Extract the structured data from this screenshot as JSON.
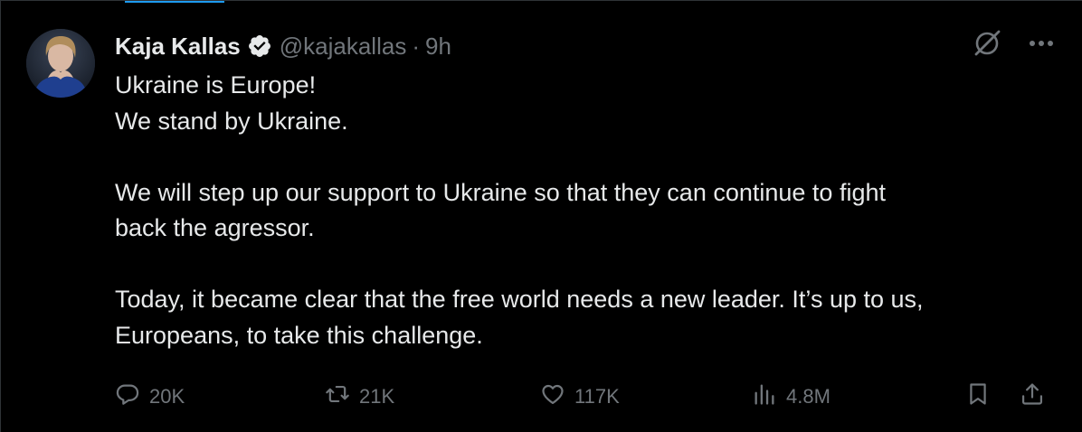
{
  "author": {
    "name": "Kaja Kallas",
    "handle": "@kajakallas",
    "separator": "·",
    "time": "9h"
  },
  "tweet": {
    "paragraphs": [
      [
        "Ukraine is Europe!",
        "We stand by Ukraine."
      ],
      [
        "We will step up our support to Ukraine so that they can continue to fight",
        "back the agressor."
      ],
      [
        "Today, it became clear that the free world needs a new leader. It’s up to us,",
        "Europeans, to take this challenge."
      ]
    ]
  },
  "actions": {
    "replies": "20K",
    "reposts": "21K",
    "likes": "117K",
    "views": "4.8M"
  },
  "icons": {
    "verified": "verified-badge-icon",
    "grok": "grok-icon",
    "more": "more-icon",
    "reply": "reply-icon",
    "repost": "repost-icon",
    "like": "heart-icon",
    "views": "views-icon",
    "bookmark": "bookmark-icon",
    "share": "share-icon"
  },
  "colors": {
    "background": "#000000",
    "text": "#e7e9ea",
    "muted": "#71767b",
    "accent": "#1d9bf0"
  }
}
